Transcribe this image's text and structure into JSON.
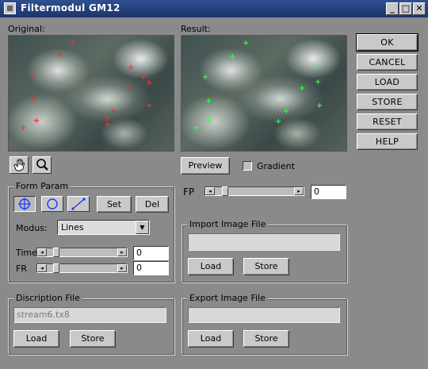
{
  "window": {
    "title": "Filtermodul GM12",
    "controls": [
      "minimize-icon",
      "maximize-icon",
      "close-icon"
    ]
  },
  "panels": {
    "original_label": "Original:",
    "result_label": "Result:"
  },
  "tools": {
    "hand": "hand-icon",
    "zoom": "magnifier-icon"
  },
  "preview": {
    "button": "Preview",
    "gradient_label": "Gradient",
    "gradient_checked": false
  },
  "fp": {
    "label": "FP",
    "value": "0",
    "level": 0.1
  },
  "form_param": {
    "title": "Form Param",
    "shapes": [
      "grid-shape-icon",
      "circle-shape-icon",
      "line-shape-icon"
    ],
    "set": "Set",
    "del": "Del",
    "modus_label": "Modus:",
    "modus_value": "Lines",
    "time_label": "Time",
    "time_value": "0",
    "time_level": 0.1,
    "fr_label": "FR",
    "fr_value": "0",
    "fr_level": 0.1
  },
  "description_file": {
    "title": "Discription File",
    "filename": "stream6.tx8",
    "load": "Load",
    "store": "Store"
  },
  "import_image": {
    "title": "Import Image File",
    "value": "",
    "load": "Load",
    "store": "Store"
  },
  "export_image": {
    "title": "Export Image File",
    "value": "",
    "load": "Load",
    "store": "Store"
  },
  "side_buttons": {
    "ok": "OK",
    "cancel": "CANCEL",
    "load": "LOAD",
    "store": "STORE",
    "reset": "RESET",
    "help": "HELP"
  },
  "colors": {
    "titlebar": "#2f4f8f",
    "marker_original": "#ff2a2a",
    "marker_result": "#2bff45",
    "active_shape": "#1a3cff"
  }
}
